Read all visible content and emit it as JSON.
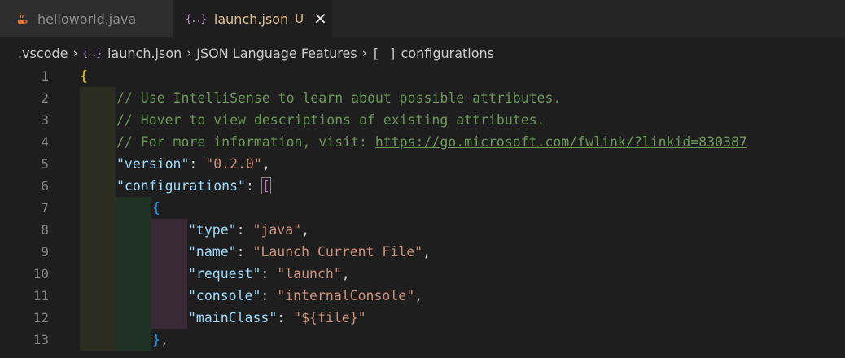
{
  "tabs": [
    {
      "label": "helloworld.java",
      "icon": "java-icon",
      "active": false
    },
    {
      "label": "launch.json",
      "icon": "json-icon",
      "active": true,
      "status": "U",
      "close": "✕"
    }
  ],
  "breadcrumb": {
    "items": [
      ".vscode",
      "launch.json",
      "JSON Language Features",
      "configurations"
    ],
    "separator": "›",
    "json_icon": "{..}",
    "array_icon": "[ ]"
  },
  "editor": {
    "line_numbers": [
      "1",
      "2",
      "3",
      "4",
      "5",
      "6",
      "7",
      "8",
      "9",
      "10",
      "11",
      "12",
      "13"
    ],
    "lines": {
      "l1_brace": "{",
      "l2_comment": "// Use IntelliSense to learn about possible attributes.",
      "l3_comment": "// Hover to view descriptions of existing attributes.",
      "l4_comment": "// For more information, visit: ",
      "l4_link": "https://go.microsoft.com/fwlink/?linkid=830387",
      "l5_key": "\"version\"",
      "l5_value": "\"0.2.0\"",
      "l6_key": "\"configurations\"",
      "l6_bracket": "[",
      "l7_brace": "{",
      "l8_key": "\"type\"",
      "l8_value": "\"java\"",
      "l9_key": "\"name\"",
      "l9_value": "\"Launch Current File\"",
      "l10_key": "\"request\"",
      "l10_value": "\"launch\"",
      "l11_key": "\"console\"",
      "l11_value": "\"internalConsole\"",
      "l12_key": "\"mainClass\"",
      "l12_value": "\"${file}\"",
      "l13_brace": "}",
      "colon": ": ",
      "comma": ","
    }
  },
  "colors": {
    "background": "#1e1e1e",
    "tab_modified": "#e2c08d",
    "comment": "#6a9955",
    "key": "#9cdcfe",
    "string": "#ce9178",
    "bracket_level1": "#ffd700",
    "bracket_level2": "#da70d6",
    "bracket_level3": "#179fff"
  }
}
